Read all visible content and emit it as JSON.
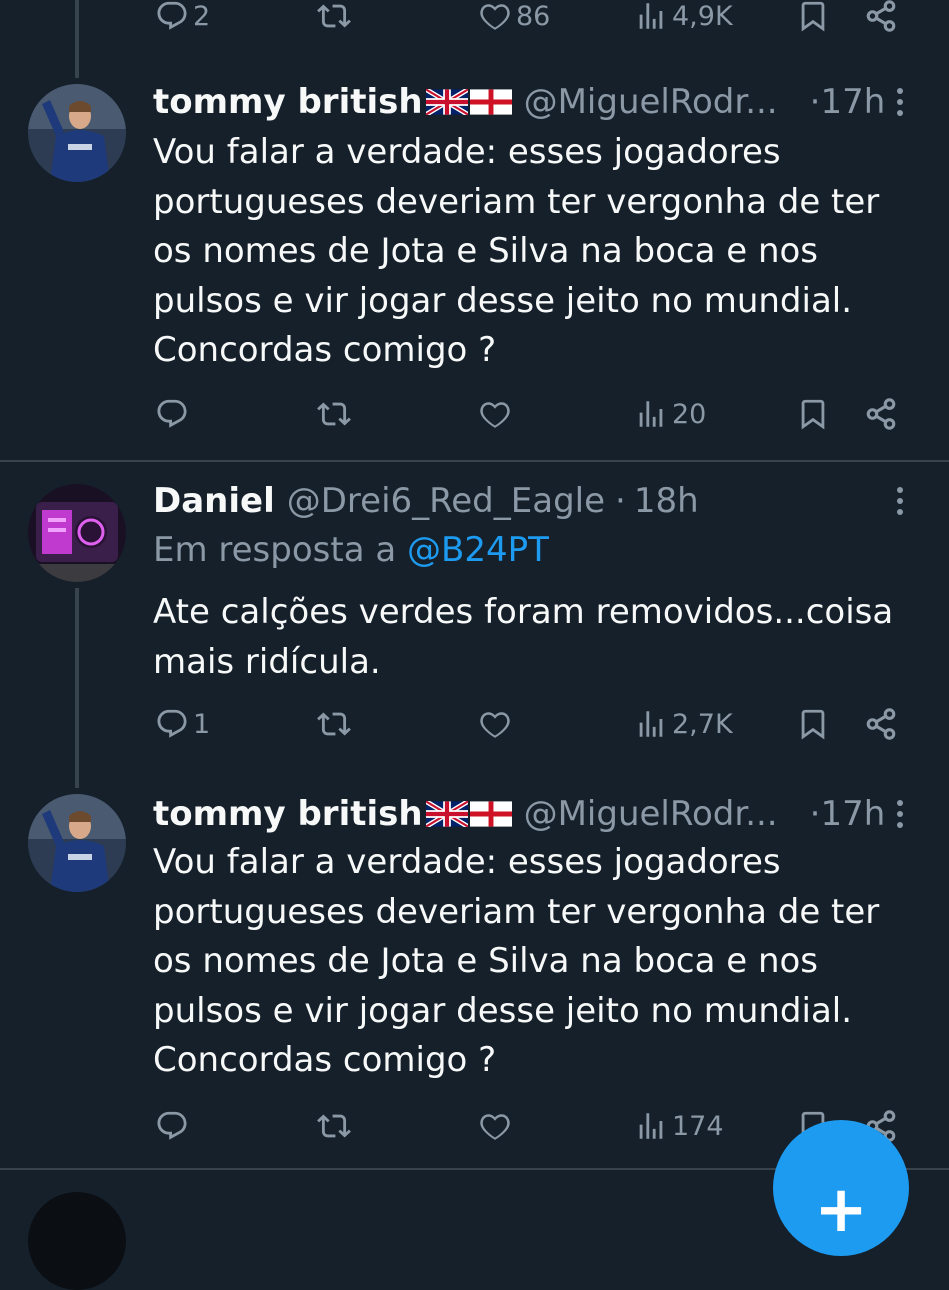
{
  "top_actions": {
    "reply_count": "2",
    "retweet_count": "",
    "like_count": "86",
    "views_count": "4,9K"
  },
  "tweets": [
    {
      "name": "tommy british",
      "handle": "@MiguelRodr...",
      "separator": "·",
      "time": "17h",
      "reply_prefix": "",
      "reply_mention": "",
      "body": "Vou falar a verdade: esses jogadores portugueses deveriam ter vergonha de ter os nomes de Jota e Silva na boca e nos pulsos e vir jogar desse jeito no mundial. Concordas comigo ?",
      "actions": {
        "reply_count": "",
        "retweet_count": "",
        "like_count": "",
        "views_count": "20"
      }
    },
    {
      "name": "Daniel",
      "handle": "@Drei6_Red_Eagle",
      "separator": "·",
      "time": "18h",
      "reply_prefix": "Em resposta a ",
      "reply_mention": "@B24PT",
      "body": "Ate calções verdes foram removidos...coisa mais ridícula.",
      "actions": {
        "reply_count": "1",
        "retweet_count": "",
        "like_count": "",
        "views_count": "2,7K"
      }
    },
    {
      "name": "tommy british",
      "handle": "@MiguelRodr...",
      "separator": "·",
      "time": "17h",
      "reply_prefix": "",
      "reply_mention": "",
      "body": "Vou falar a verdade: esses jogadores portugueses deveriam ter vergonha de ter os nomes de Jota e Silva na boca e nos pulsos e vir jogar desse jeito no mundial. Concordas comigo ?",
      "actions": {
        "reply_count": "",
        "retweet_count": "",
        "like_count": "",
        "views_count": "174"
      }
    }
  ],
  "fab": {
    "label": "+"
  },
  "colors": {
    "background": "#15202b",
    "text": "#f7f9f9",
    "muted": "#8b98a5",
    "accent": "#1d9bf0",
    "divider": "#38444d"
  },
  "icons": [
    "reply-icon",
    "retweet-icon",
    "like-icon",
    "views-icon",
    "bookmark-icon",
    "share-icon",
    "more-icon",
    "uk-flag-icon",
    "england-flag-icon",
    "compose-icon"
  ]
}
